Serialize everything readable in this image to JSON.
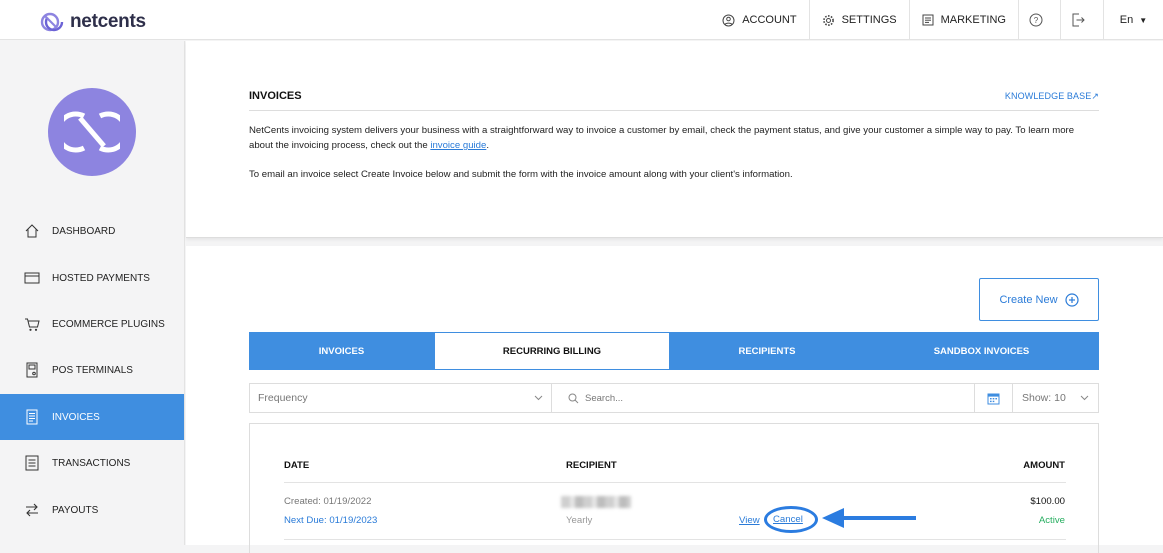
{
  "brand": {
    "name": "netcents",
    "accent": "#3f8ee0",
    "avatar_color": "#8d84e0"
  },
  "topnav": {
    "account": "ACCOUNT",
    "settings": "SETTINGS",
    "marketing": "MARKETING",
    "language": "En"
  },
  "sidebar": {
    "items": [
      {
        "label": "DASHBOARD",
        "icon": "home-icon"
      },
      {
        "label": "HOSTED PAYMENTS",
        "icon": "card-icon"
      },
      {
        "label": "ECOMMERCE PLUGINS",
        "icon": "cart-icon"
      },
      {
        "label": "POS TERMINALS",
        "icon": "pos-icon"
      },
      {
        "label": "INVOICES",
        "icon": "invoice-icon",
        "active": true
      },
      {
        "label": "TRANSACTIONS",
        "icon": "transactions-icon"
      },
      {
        "label": "PAYOUTS",
        "icon": "payouts-icon"
      }
    ]
  },
  "intro": {
    "title": "INVOICES",
    "knowledge_base": "KNOWLEDGE BASE",
    "para1_pre": "NetCents invoicing system delivers your business with a straightforward way to invoice a customer by email, check the payment status, and give your customer a simple way to pay. To learn more about the invoicing process, check out the ",
    "para1_link": "invoice guide",
    "para1_post": ".",
    "para2": "To email an invoice select Create Invoice below and submit the form with the invoice amount along with your client's information."
  },
  "actions": {
    "create_new": "Create New"
  },
  "tabs": [
    {
      "label": "INVOICES"
    },
    {
      "label": "RECURRING BILLING",
      "active": true
    },
    {
      "label": "RECIPIENTS"
    },
    {
      "label": "SANDBOX INVOICES"
    }
  ],
  "filters": {
    "frequency_placeholder": "Frequency",
    "search_placeholder": "Search...",
    "show": "Show: 10"
  },
  "table": {
    "headers": {
      "date": "DATE",
      "recipient": "RECIPIENT",
      "amount": "AMOUNT"
    },
    "rows": [
      {
        "created": "Created: 01/19/2022",
        "next_due": "Next Due: 01/19/2023",
        "frequency": "Yearly",
        "view": "View",
        "cancel": "Cancel",
        "amount": "$100.00",
        "status": "Active",
        "status_color": "#27ae60"
      }
    ]
  }
}
